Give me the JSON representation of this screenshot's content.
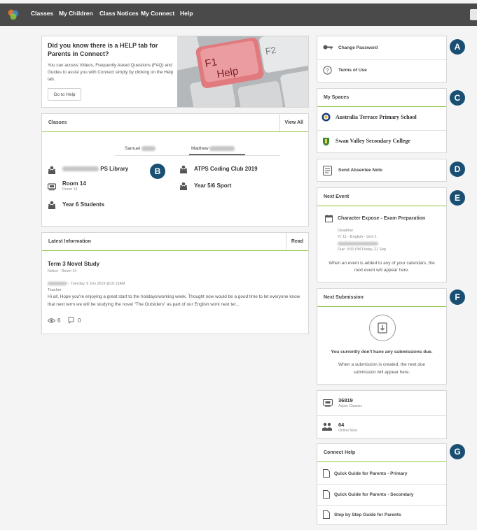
{
  "nav": {
    "items": [
      "Classes",
      "My Children",
      "Class Notices",
      "My Connect",
      "Help"
    ]
  },
  "banner": {
    "title": "Did you know there is a HELP tab for Parents in Connect?",
    "description": "You can access Videos, Frequently Asked Questions (FAQ) and Guides to assist you with Connect simply by clicking on the Help tab.",
    "button": "Go to Help",
    "key_label_f1": "F1",
    "key_label_help": "Help",
    "key_label_f2": "F2"
  },
  "classes": {
    "title": "Classes",
    "view_all": "View All",
    "tabs": [
      "Samuel",
      "Matthew"
    ],
    "items": [
      {
        "name": "PS Library",
        "sub": ""
      },
      {
        "name": "Room 14",
        "sub": "Room 14"
      },
      {
        "name": "Year 6 Students",
        "sub": ""
      },
      {
        "name": "ATPS Coding Club 2019",
        "sub": ""
      },
      {
        "name": "Year 5/6 Sport",
        "sub": ""
      }
    ]
  },
  "latest": {
    "title": "Latest Information",
    "read": "Read",
    "post_title": "Term 3 Novel Study",
    "post_sub": "Notice - Room 14",
    "post_meta": "- Tuesday, 9 July 2019 @10:13AM",
    "post_role": "Teacher",
    "post_body": "Hi all, Hope you're enjoying a great start to the holidays/working week. Thought now would be a good time to let everyone know that next term we will be studying the novel \"The Outsiders\" as part of our English work next ter...",
    "views": "6",
    "comments": "0"
  },
  "account": {
    "change_password": "Change Password",
    "terms": "Terms of Use"
  },
  "spaces": {
    "title": "My Spaces",
    "schools": [
      "Australia Terrace Primary School",
      "Swan Valley Secondary College"
    ]
  },
  "absentee": {
    "label": "Send Absentee Note"
  },
  "next_event": {
    "title": "Next Event",
    "event_name": "Character Expose - Exam Preparation",
    "kind": "Deadline",
    "subject": "Yr 11 - English - Unit 1",
    "due": "Due: 3:00 PM Friday, 21 Sep",
    "note": "When an event is added to any of your calendars, the next event will appear here."
  },
  "next_submission": {
    "title": "Next Submission",
    "none": "You currently don't have any submissions due.",
    "note": "When a submission is created, the next due submission will appear here."
  },
  "stats": {
    "active_classes_value": "36819",
    "active_classes_label": "Active Classes",
    "online_value": "64",
    "online_label": "Online Now"
  },
  "connect_help": {
    "title": "Connect Help",
    "guides": [
      "Quick Guide for Parents - Primary",
      "Quick Guide for Parents - Secondary",
      "Step by Step Guide for Parents"
    ]
  },
  "badges": [
    "A",
    "B",
    "C",
    "D",
    "E",
    "F",
    "G"
  ],
  "colors": {
    "topbar": "#4a4a4a",
    "accent_line": "#8cc63f",
    "badge": "#1a4f74",
    "key_red": "#e07a7f"
  }
}
